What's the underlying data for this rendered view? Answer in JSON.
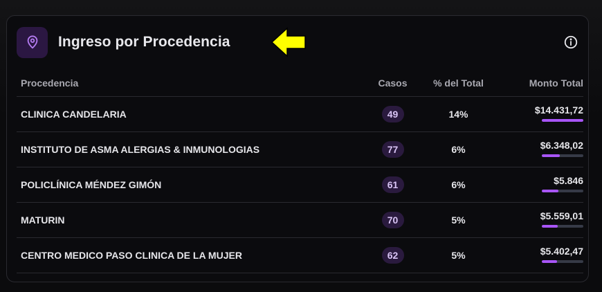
{
  "header": {
    "title": "Ingreso por Procedencia",
    "icon": "map-pin-icon",
    "info_icon": "info-icon",
    "annotation_arrow_color": "#ffff00"
  },
  "table": {
    "columns": [
      "Procedencia",
      "Casos",
      "% del Total",
      "Monto Total"
    ],
    "rows": [
      {
        "procedencia": "CLINICA CANDELARIA",
        "casos": "49",
        "pct": "14%",
        "monto": "$14.431,72",
        "bar_fraction": 1.0
      },
      {
        "procedencia": "INSTITUTO DE ASMA ALERGIAS & INMUNOLOGIAS",
        "casos": "77",
        "pct": "6%",
        "monto": "$6.348,02",
        "bar_fraction": 0.44
      },
      {
        "procedencia": "POLICLÍNICA MÉNDEZ GIMÓN",
        "casos": "61",
        "pct": "6%",
        "monto": "$5.846",
        "bar_fraction": 0.405
      },
      {
        "procedencia": "MATURIN",
        "casos": "70",
        "pct": "5%",
        "monto": "$5.559,01",
        "bar_fraction": 0.385
      },
      {
        "procedencia": "CENTRO MEDICO PASO CLINICA DE LA MUJER",
        "casos": "62",
        "pct": "5%",
        "monto": "$5.402,47",
        "bar_fraction": 0.374
      }
    ]
  },
  "colors": {
    "accent": "#a855f7",
    "badge_bg": "#2a1a3e",
    "icon_bg": "#2b1742"
  }
}
